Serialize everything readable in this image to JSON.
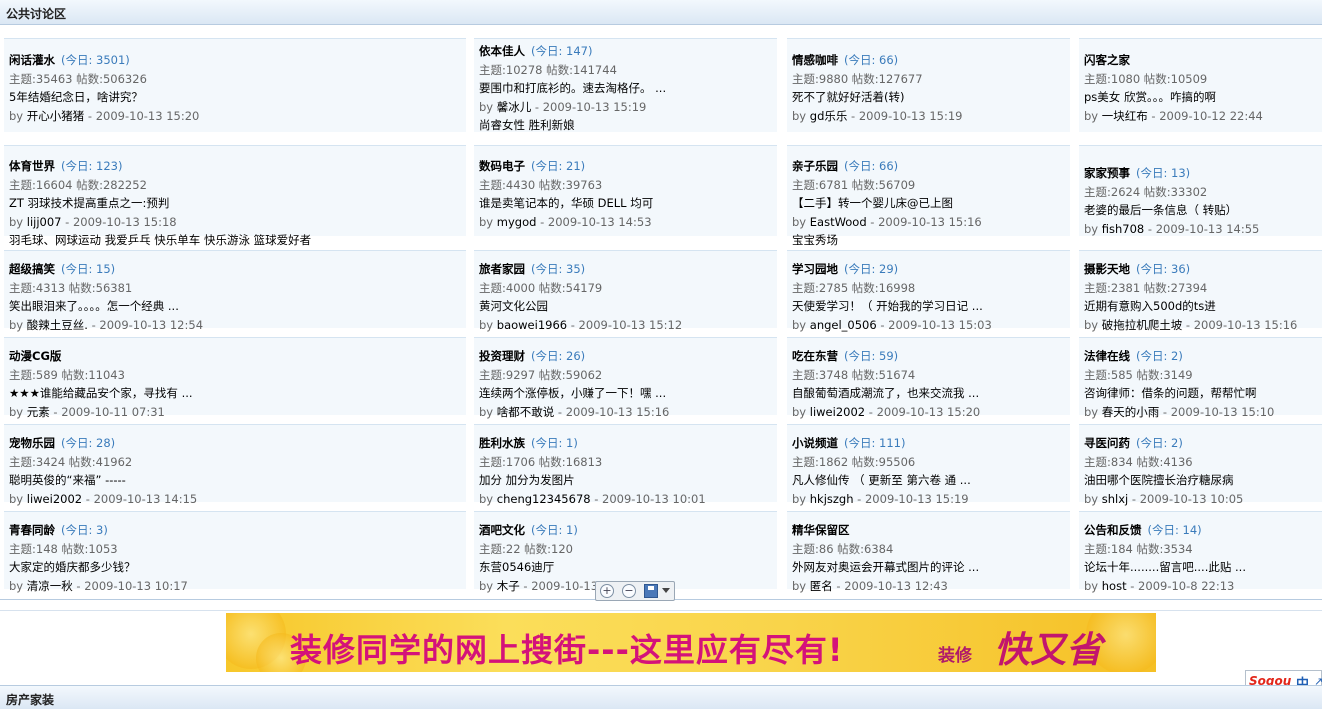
{
  "section_title": "公共讨论区",
  "footer_title": "房产家装",
  "banner": {
    "text": "装修同学的网上搜街---这里应有尽有!",
    "brand_small": "装修",
    "brand": "快又省"
  },
  "ime": {
    "logo": "Sogou",
    "lang": "中"
  },
  "zoom": {
    "in": "+",
    "out": "−"
  },
  "forums": [
    {
      "name": "闲话灌水",
      "today": "(今日: 3501)",
      "stats": "主题:35463  帖数:506326",
      "topic": "5年结婚纪念日，啥讲究？",
      "by": "by",
      "author": "开心小猪猪",
      "date": " - 2009-10-13 15:20",
      "extra": ""
    },
    {
      "name": "依本佳人",
      "today": "(今日: 147)",
      "stats": "主题:10278  帖数:141744",
      "topic": "要围巾和打底衫的。速去淘格仔。 ...",
      "by": "by",
      "author": "馨冰儿",
      "date": " - 2009-10-13 15:19",
      "extra": "尚睿女性  胜利新娘"
    },
    {
      "name": "情感咖啡",
      "today": "(今日: 66)",
      "stats": "主题:9880  帖数:127677",
      "topic": "死不了就好好活着(转)",
      "by": "by",
      "author": "gd乐乐",
      "date": " - 2009-10-13 15:19",
      "extra": ""
    },
    {
      "name": "闪客之家",
      "today": "",
      "stats": "主题:1080  帖数:10509",
      "topic": "ps美女  欣赏。。。咋搞的啊",
      "by": "by",
      "author": "一块红布",
      "date": " - 2009-10-12 22:44",
      "extra": ""
    },
    {
      "name": "体育世界",
      "today": "(今日: 123)",
      "stats": "主题:16604  帖数:282252",
      "topic": "ZT 羽球技术提高重点之一:预判",
      "by": "by",
      "author": "lijj007",
      "date": " - 2009-10-13 15:18",
      "extra": "羽毛球、网球运动  我爱乒乓  快乐单车  快乐游泳  篮球爱好者"
    },
    {
      "name": "数码电子",
      "today": "(今日: 21)",
      "stats": "主题:4430  帖数:39763",
      "topic": "谁是卖笔记本的，华硕  DELL 均可",
      "by": "by",
      "author": "mygod",
      "date": " - 2009-10-13 14:53",
      "extra": ""
    },
    {
      "name": "亲子乐园",
      "today": "(今日: 66)",
      "stats": "主题:6781  帖数:56709",
      "topic": "【二手】转一个婴儿床@已上图",
      "by": "by",
      "author": "EastWood",
      "date": " - 2009-10-13 15:16",
      "extra": "宝宝秀场"
    },
    {
      "name": "家家预事",
      "today": "(今日: 13)",
      "stats": "主题:2624  帖数:33302",
      "topic": "老婆的最后一条信息（ 转贴）",
      "by": "by",
      "author": "fish708",
      "date": " - 2009-10-13 14:55",
      "extra": ""
    },
    {
      "name": "超级搞笑",
      "today": "(今日: 15)",
      "stats": "主题:4313  帖数:56381",
      "topic": "笑出眼泪来了。。。。怎一个经典  ...",
      "by": "by",
      "author": "酸辣土豆丝.",
      "date": " - 2009-10-13 12:54",
      "extra": ""
    },
    {
      "name": "旅者家园",
      "today": "(今日: 35)",
      "stats": "主题:4000  帖数:54179",
      "topic": "黄河文化公园",
      "by": "by",
      "author": "baowei1966",
      "date": " - 2009-10-13 15:12",
      "extra": ""
    },
    {
      "name": "学习园地",
      "today": "(今日: 29)",
      "stats": "主题:2785  帖数:16998",
      "topic": "天使爱学习！（ 开始我的学习日记  ...",
      "by": "by",
      "author": "angel_0506",
      "date": " - 2009-10-13 15:03",
      "extra": ""
    },
    {
      "name": "摄影天地",
      "today": "(今日: 36)",
      "stats": "主题:2381  帖数:27394",
      "topic": "近期有意购入500d的ts进",
      "by": "by",
      "author": "破拖拉机爬土坡",
      "date": " - 2009-10-13 15:16",
      "extra": ""
    },
    {
      "name": "动漫CG版",
      "today": "",
      "stats": "主题:589  帖数:11043",
      "topic": "★★★谁能给藏品安个家，寻找有  ...",
      "by": "by",
      "author": "元素",
      "date": " - 2009-10-11 07:31",
      "extra": ""
    },
    {
      "name": "投资理财",
      "today": "(今日: 26)",
      "stats": "主题:9297  帖数:59062",
      "topic": "连续两个涨停板，小赚了一下！嘿  ...",
      "by": "by",
      "author": "啥都不敢说",
      "date": " - 2009-10-13 15:16",
      "extra": ""
    },
    {
      "name": "吃在东营",
      "today": "(今日: 59)",
      "stats": "主题:3748  帖数:51674",
      "topic": "自酿葡萄酒成潮流了，也来交流我  ...",
      "by": "by",
      "author": "liwei2002",
      "date": " - 2009-10-13 15:20",
      "extra": ""
    },
    {
      "name": "法律在线",
      "today": "(今日: 2)",
      "stats": "主题:585  帖数:3149",
      "topic": "咨询律师：借条的问题，帮帮忙啊",
      "by": "by",
      "author": "春天的小雨",
      "date": " - 2009-10-13 15:10",
      "extra": ""
    },
    {
      "name": "宠物乐园",
      "today": "(今日: 28)",
      "stats": "主题:3424  帖数:41962",
      "topic": "聪明英俊的“来福” -----",
      "by": "by",
      "author": "liwei2002",
      "date": " - 2009-10-13 14:15",
      "extra": ""
    },
    {
      "name": "胜利水族",
      "today": "(今日: 1)",
      "stats": "主题:1706  帖数:16813",
      "topic": "加分  加分为发图片",
      "by": "by",
      "author": "cheng12345678",
      "date": " - 2009-10-13 10:01",
      "extra": ""
    },
    {
      "name": "小说频道",
      "today": "(今日: 111)",
      "stats": "主题:1862  帖数:95506",
      "topic": "凡人修仙传  （ 更新至  第六卷  通  ...",
      "by": "by",
      "author": "hkjszgh",
      "date": " - 2009-10-13 15:19",
      "extra": ""
    },
    {
      "name": "寻医问药",
      "today": "(今日: 2)",
      "stats": "主题:834  帖数:4136",
      "topic": "油田哪个医院擅长治疗糖尿病",
      "by": "by",
      "author": "shlxj",
      "date": " - 2009-10-13 10:05",
      "extra": ""
    },
    {
      "name": "青春同龄",
      "today": "(今日: 3)",
      "stats": "主题:148  帖数:1053",
      "topic": "大家定的婚庆都多少钱？",
      "by": "by",
      "author": "清凉一秋",
      "date": " - 2009-10-13 10:17",
      "extra": ""
    },
    {
      "name": "酒吧文化",
      "today": "(今日: 1)",
      "stats": "主题:22  帖数:120",
      "topic": "东营0546迪厅",
      "by": "by",
      "author": "木子",
      "date": " - 2009-10-13 10:05",
      "extra": ""
    },
    {
      "name": "精华保留区",
      "today": "",
      "stats": "主题:86  帖数:6384",
      "topic": "外网友对奥运会开幕式图片的评论  ...",
      "by": "by",
      "author": "匿名",
      "date": " - 2009-10-13 12:43",
      "extra": ""
    },
    {
      "name": "公告和反馈",
      "today": "(今日: 14)",
      "stats": "主题:184  帖数:3534",
      "topic": "论坛十年........留言吧....此贴  ...",
      "by": "by",
      "author": "host",
      "date": " - 2009-10-8 22:13",
      "extra": ""
    }
  ]
}
